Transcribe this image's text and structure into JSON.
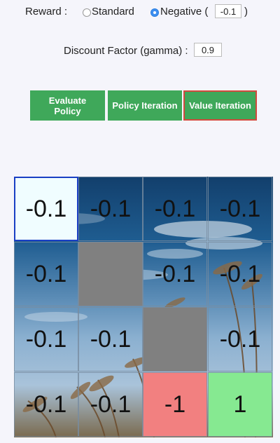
{
  "reward": {
    "label": "Reward :",
    "standard_label": "Standard",
    "negative_label": "Negative (",
    "negative_value": "-0.1",
    "close_paren": ")",
    "selected": "negative"
  },
  "discount": {
    "label": "Discount Factor (gamma) :",
    "value": "0.9"
  },
  "buttons": {
    "evaluate": "Evaluate Policy",
    "policy": "Policy Iteration",
    "value": "Value Iteration"
  },
  "grid": {
    "cells": [
      [
        "-0.1",
        "-0.1",
        "-0.1",
        "-0.1"
      ],
      [
        "-0.1",
        "",
        "-0.1",
        "-0.1"
      ],
      [
        "-0.1",
        "-0.1",
        "",
        "-0.1"
      ],
      [
        "-0.1",
        "-0.1",
        "-1",
        "1"
      ]
    ]
  },
  "colors": {
    "button_green": "#3fa85a",
    "active_outline": "#d24a3d",
    "start_cell": "#f0fdff",
    "wall": "#808080",
    "negative_terminal": "#f28080",
    "positive_terminal": "#86e991"
  }
}
